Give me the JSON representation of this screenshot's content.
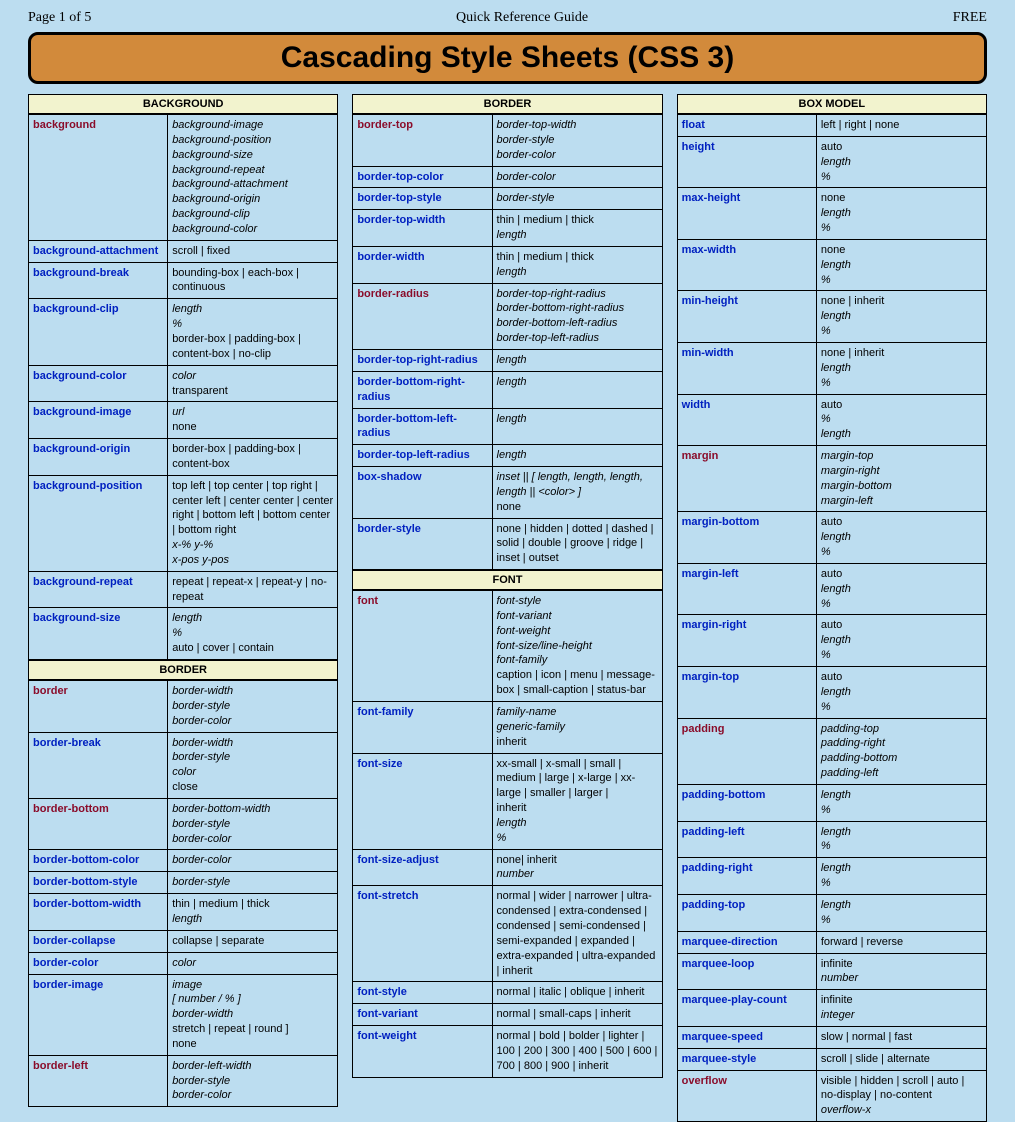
{
  "header": {
    "left": "Page 1 of 5",
    "center": "Quick Reference Guide",
    "right": "FREE"
  },
  "title": "Cascading Style Sheets (CSS 3)",
  "columns": [
    [
      {
        "type": "head",
        "text": "BACKGROUND"
      },
      {
        "type": "row",
        "prop": "background",
        "color": "red",
        "val": [
          {
            "t": "background-image",
            "i": true
          },
          {
            "t": "background-position",
            "i": true
          },
          {
            "t": "background-size",
            "i": true
          },
          {
            "t": "background-repeat",
            "i": true
          },
          {
            "t": "background-attachment",
            "i": true
          },
          {
            "t": "background-origin",
            "i": true
          },
          {
            "t": "background-clip",
            "i": true
          },
          {
            "t": "background-color",
            "i": true
          }
        ]
      },
      {
        "type": "row",
        "prop": "background-attachment",
        "color": "blue",
        "val": [
          {
            "t": "scroll | fixed"
          }
        ]
      },
      {
        "type": "row",
        "prop": "background-break",
        "color": "blue",
        "val": [
          {
            "t": "bounding-box | each-box | continuous"
          }
        ]
      },
      {
        "type": "row",
        "prop": "background-clip",
        "color": "blue",
        "val": [
          {
            "t": "length",
            "i": true
          },
          {
            "t": "%",
            "i": true
          },
          {
            "t": "border-box | padding-box | content-box | no-clip"
          }
        ]
      },
      {
        "type": "row",
        "prop": "background-color",
        "color": "blue",
        "val": [
          {
            "t": "color",
            "i": true
          },
          {
            "t": "transparent"
          }
        ]
      },
      {
        "type": "row",
        "prop": "background-image",
        "color": "blue",
        "val": [
          {
            "t": "url",
            "i": true
          },
          {
            "t": "none"
          }
        ]
      },
      {
        "type": "row",
        "prop": "background-origin",
        "color": "blue",
        "val": [
          {
            "t": "border-box | padding-box | content-box"
          }
        ]
      },
      {
        "type": "row",
        "prop": "background-position",
        "color": "blue",
        "val": [
          {
            "t": "top left | top center | top right | center left | center center | center right | bottom left | bottom center | bottom right"
          },
          {
            "t": "x-% y-%",
            "i": true
          },
          {
            "t": "x-pos y-pos",
            "i": true
          }
        ]
      },
      {
        "type": "row",
        "prop": "background-repeat",
        "color": "blue",
        "val": [
          {
            "t": "repeat | repeat-x | repeat-y | no-repeat"
          }
        ]
      },
      {
        "type": "row",
        "prop": "background-size",
        "color": "blue",
        "val": [
          {
            "t": "length",
            "i": true
          },
          {
            "t": "%",
            "i": true
          },
          {
            "t": "auto | cover | contain"
          }
        ]
      },
      {
        "type": "head",
        "text": "BORDER"
      },
      {
        "type": "row",
        "prop": "border",
        "color": "red",
        "val": [
          {
            "t": "border-width",
            "i": true
          },
          {
            "t": "border-style",
            "i": true
          },
          {
            "t": "border-color",
            "i": true
          }
        ]
      },
      {
        "type": "row",
        "prop": "border-break",
        "color": "blue",
        "val": [
          {
            "t": "border-width",
            "i": true
          },
          {
            "t": "border-style",
            "i": true
          },
          {
            "t": "color",
            "i": true
          },
          {
            "t": "close"
          }
        ]
      },
      {
        "type": "row",
        "prop": "border-bottom",
        "color": "red",
        "val": [
          {
            "t": "border-bottom-width",
            "i": true
          },
          {
            "t": "border-style",
            "i": true
          },
          {
            "t": "border-color",
            "i": true
          }
        ]
      },
      {
        "type": "row",
        "prop": "border-bottom-color",
        "color": "blue",
        "val": [
          {
            "t": "border-color",
            "i": true
          }
        ]
      },
      {
        "type": "row",
        "prop": "border-bottom-style",
        "color": "blue",
        "val": [
          {
            "t": "border-style",
            "i": true
          }
        ]
      },
      {
        "type": "row",
        "prop": "border-bottom-width",
        "color": "blue",
        "val": [
          {
            "t": "thin | medium | thick"
          },
          {
            "t": "length",
            "i": true
          }
        ]
      },
      {
        "type": "row",
        "prop": "border-collapse",
        "color": "blue",
        "val": [
          {
            "t": "collapse | separate"
          }
        ]
      },
      {
        "type": "row",
        "prop": "border-color",
        "color": "blue",
        "val": [
          {
            "t": "color",
            "i": true
          }
        ]
      },
      {
        "type": "row",
        "prop": "border-image",
        "color": "blue",
        "val": [
          {
            "t": "image",
            "i": true
          },
          {
            "t": "[ number / % ]",
            "i": true
          },
          {
            "t": "border-width",
            "i": true
          },
          {
            "t": "stretch | repeat | round ]"
          },
          {
            "t": "none"
          }
        ]
      },
      {
        "type": "row",
        "prop": "border-left",
        "color": "red",
        "val": [
          {
            "t": "border-left-width",
            "i": true
          },
          {
            "t": "border-style",
            "i": true
          },
          {
            "t": "border-color",
            "i": true
          }
        ]
      }
    ],
    [
      {
        "type": "head",
        "text": "BORDER"
      },
      {
        "type": "row",
        "prop": "border-top",
        "color": "red",
        "val": [
          {
            "t": "border-top-width",
            "i": true
          },
          {
            "t": "border-style",
            "i": true
          },
          {
            "t": "border-color",
            "i": true
          }
        ]
      },
      {
        "type": "row",
        "prop": "border-top-color",
        "color": "blue",
        "val": [
          {
            "t": "border-color",
            "i": true
          }
        ]
      },
      {
        "type": "row",
        "prop": "border-top-style",
        "color": "blue",
        "val": [
          {
            "t": "border-style",
            "i": true
          }
        ]
      },
      {
        "type": "row",
        "prop": "border-top-width",
        "color": "blue",
        "val": [
          {
            "t": "thin | medium | thick"
          },
          {
            "t": "length",
            "i": true
          }
        ]
      },
      {
        "type": "row",
        "prop": "border-width",
        "color": "blue",
        "val": [
          {
            "t": "thin | medium | thick"
          },
          {
            "t": "length",
            "i": true
          }
        ]
      },
      {
        "type": "row",
        "prop": "border-radius",
        "color": "red",
        "val": [
          {
            "t": "border-top-right-radius",
            "i": true
          },
          {
            "t": "border-bottom-right-radius",
            "i": true
          },
          {
            "t": "border-bottom-left-radius",
            "i": true
          },
          {
            "t": "border-top-left-radius",
            "i": true
          }
        ]
      },
      {
        "type": "row",
        "prop": "border-top-right-radius",
        "color": "blue",
        "val": [
          {
            "t": "length",
            "i": true
          }
        ]
      },
      {
        "type": "row",
        "prop": "border-bottom-right-radius",
        "color": "blue",
        "val": [
          {
            "t": "length",
            "i": true
          }
        ]
      },
      {
        "type": "row",
        "prop": "border-bottom-left-radius",
        "color": "blue",
        "val": [
          {
            "t": "length",
            "i": true
          }
        ]
      },
      {
        "type": "row",
        "prop": "border-top-left-radius",
        "color": "blue",
        "val": [
          {
            "t": "length",
            "i": true
          }
        ]
      },
      {
        "type": "row",
        "prop": "box-shadow",
        "color": "blue",
        "val": [
          {
            "t": "inset || [ length, length, length, length || <color> ]",
            "i": true
          },
          {
            "t": "none"
          }
        ]
      },
      {
        "type": "row",
        "prop": "border-style",
        "color": "blue",
        "val": [
          {
            "t": "none | hidden | dotted | dashed | solid | double | groove | ridge | inset | outset"
          }
        ]
      },
      {
        "type": "head",
        "text": "FONT"
      },
      {
        "type": "row",
        "prop": "font",
        "color": "red",
        "val": [
          {
            "t": "font-style",
            "i": true
          },
          {
            "t": "font-variant",
            "i": true
          },
          {
            "t": "font-weight",
            "i": true
          },
          {
            "t": "font-size/line-height",
            "i": true
          },
          {
            "t": "font-family",
            "i": true
          },
          {
            "t": "caption | icon | menu | message-box | small-caption | status-bar"
          }
        ]
      },
      {
        "type": "row",
        "prop": "font-family",
        "color": "blue",
        "val": [
          {
            "t": "family-name",
            "i": true
          },
          {
            "t": "generic-family",
            "i": true
          },
          {
            "t": "inherit"
          }
        ]
      },
      {
        "type": "row",
        "prop": "font-size",
        "color": "blue",
        "val": [
          {
            "t": "xx-small | x-small | small | medium | large | x-large | xx-large | smaller | larger |"
          },
          {
            "t": "inherit"
          },
          {
            "t": "length",
            "i": true
          },
          {
            "t": "%",
            "i": true
          }
        ]
      },
      {
        "type": "row",
        "prop": "font-size-adjust",
        "color": "blue",
        "val": [
          {
            "t": "none| inherit"
          },
          {
            "t": "number",
            "i": true
          }
        ]
      },
      {
        "type": "row",
        "prop": "font-stretch",
        "color": "blue",
        "val": [
          {
            "t": "normal | wider | narrower | ultra-condensed | extra-condensed | condensed | semi-condensed | semi-expanded | expanded | extra-expanded | ultra-expanded | inherit"
          }
        ]
      },
      {
        "type": "row",
        "prop": "font-style",
        "color": "blue",
        "val": [
          {
            "t": "normal | italic | oblique | inherit"
          }
        ]
      },
      {
        "type": "row",
        "prop": "font-variant",
        "color": "blue",
        "val": [
          {
            "t": "normal | small-caps | inherit"
          }
        ]
      },
      {
        "type": "row",
        "prop": "font-weight",
        "color": "blue",
        "val": [
          {
            "t": "normal | bold | bolder | lighter | 100 | 200 | 300 | 400 | 500 | 600 | 700 | 800 | 900 | inherit"
          }
        ]
      }
    ],
    [
      {
        "type": "head",
        "text": "BOX MODEL"
      },
      {
        "type": "row",
        "prop": "float",
        "color": "blue",
        "val": [
          {
            "t": "left | right | none"
          }
        ]
      },
      {
        "type": "row",
        "prop": "height",
        "color": "blue",
        "val": [
          {
            "t": "auto"
          },
          {
            "t": "length",
            "i": true
          },
          {
            "t": "%",
            "i": true
          }
        ]
      },
      {
        "type": "row",
        "prop": "max-height",
        "color": "blue",
        "val": [
          {
            "t": "none"
          },
          {
            "t": "length",
            "i": true
          },
          {
            "t": "%",
            "i": true
          }
        ]
      },
      {
        "type": "row",
        "prop": "max-width",
        "color": "blue",
        "val": [
          {
            "t": "none"
          },
          {
            "t": "length",
            "i": true
          },
          {
            "t": "%",
            "i": true
          }
        ]
      },
      {
        "type": "row",
        "prop": "min-height",
        "color": "blue",
        "val": [
          {
            "t": "none | inherit"
          },
          {
            "t": "length",
            "i": true
          },
          {
            "t": "%",
            "i": true
          }
        ]
      },
      {
        "type": "row",
        "prop": "min-width",
        "color": "blue",
        "val": [
          {
            "t": "none | inherit"
          },
          {
            "t": "length",
            "i": true
          },
          {
            "t": "%",
            "i": true
          }
        ]
      },
      {
        "type": "row",
        "prop": "width",
        "color": "blue",
        "val": [
          {
            "t": "auto"
          },
          {
            "t": "%",
            "i": true
          },
          {
            "t": "length",
            "i": true
          }
        ]
      },
      {
        "type": "row",
        "prop": "margin",
        "color": "red",
        "val": [
          {
            "t": "margin-top",
            "i": true
          },
          {
            "t": "margin-right",
            "i": true
          },
          {
            "t": "margin-bottom",
            "i": true
          },
          {
            "t": "margin-left",
            "i": true
          }
        ]
      },
      {
        "type": "row",
        "prop": "margin-bottom",
        "color": "blue",
        "val": [
          {
            "t": "auto"
          },
          {
            "t": "length",
            "i": true
          },
          {
            "t": "%",
            "i": true
          }
        ]
      },
      {
        "type": "row",
        "prop": "margin-left",
        "color": "blue",
        "val": [
          {
            "t": "auto"
          },
          {
            "t": "length",
            "i": true
          },
          {
            "t": "%",
            "i": true
          }
        ]
      },
      {
        "type": "row",
        "prop": "margin-right",
        "color": "blue",
        "val": [
          {
            "t": "auto"
          },
          {
            "t": "length",
            "i": true
          },
          {
            "t": "%",
            "i": true
          }
        ]
      },
      {
        "type": "row",
        "prop": "margin-top",
        "color": "blue",
        "val": [
          {
            "t": "auto"
          },
          {
            "t": "length",
            "i": true
          },
          {
            "t": "%",
            "i": true
          }
        ]
      },
      {
        "type": "row",
        "prop": "padding",
        "color": "red",
        "val": [
          {
            "t": "padding-top",
            "i": true
          },
          {
            "t": "padding-right",
            "i": true
          },
          {
            "t": "padding-bottom",
            "i": true
          },
          {
            "t": "padding-left",
            "i": true
          }
        ]
      },
      {
        "type": "row",
        "prop": "padding-bottom",
        "color": "blue",
        "val": [
          {
            "t": "length",
            "i": true
          },
          {
            "t": "%",
            "i": true
          }
        ]
      },
      {
        "type": "row",
        "prop": "padding-left",
        "color": "blue",
        "val": [
          {
            "t": "length",
            "i": true
          },
          {
            "t": "%",
            "i": true
          }
        ]
      },
      {
        "type": "row",
        "prop": "padding-right",
        "color": "blue",
        "val": [
          {
            "t": "length",
            "i": true
          },
          {
            "t": "%",
            "i": true
          }
        ]
      },
      {
        "type": "row",
        "prop": "padding-top",
        "color": "blue",
        "val": [
          {
            "t": "length",
            "i": true
          },
          {
            "t": "%",
            "i": true
          }
        ]
      },
      {
        "type": "row",
        "prop": "marquee-direction",
        "color": "blue",
        "val": [
          {
            "t": "forward | reverse"
          }
        ]
      },
      {
        "type": "row",
        "prop": "marquee-loop",
        "color": "blue",
        "val": [
          {
            "t": "infinite"
          },
          {
            "t": "number",
            "i": true
          }
        ]
      },
      {
        "type": "row",
        "prop": "marquee-play-count",
        "color": "blue",
        "val": [
          {
            "t": "infinite"
          },
          {
            "t": "integer",
            "i": true
          }
        ]
      },
      {
        "type": "row",
        "prop": "marquee-speed",
        "color": "blue",
        "val": [
          {
            "t": "slow | normal | fast"
          }
        ]
      },
      {
        "type": "row",
        "prop": "marquee-style",
        "color": "blue",
        "val": [
          {
            "t": "scroll | slide | alternate"
          }
        ]
      },
      {
        "type": "row",
        "prop": "overflow",
        "color": "red",
        "val": [
          {
            "t": "visible | hidden | scroll | auto | no-display | no-content"
          },
          {
            "t": "overflow-x",
            "i": true
          }
        ]
      }
    ]
  ]
}
